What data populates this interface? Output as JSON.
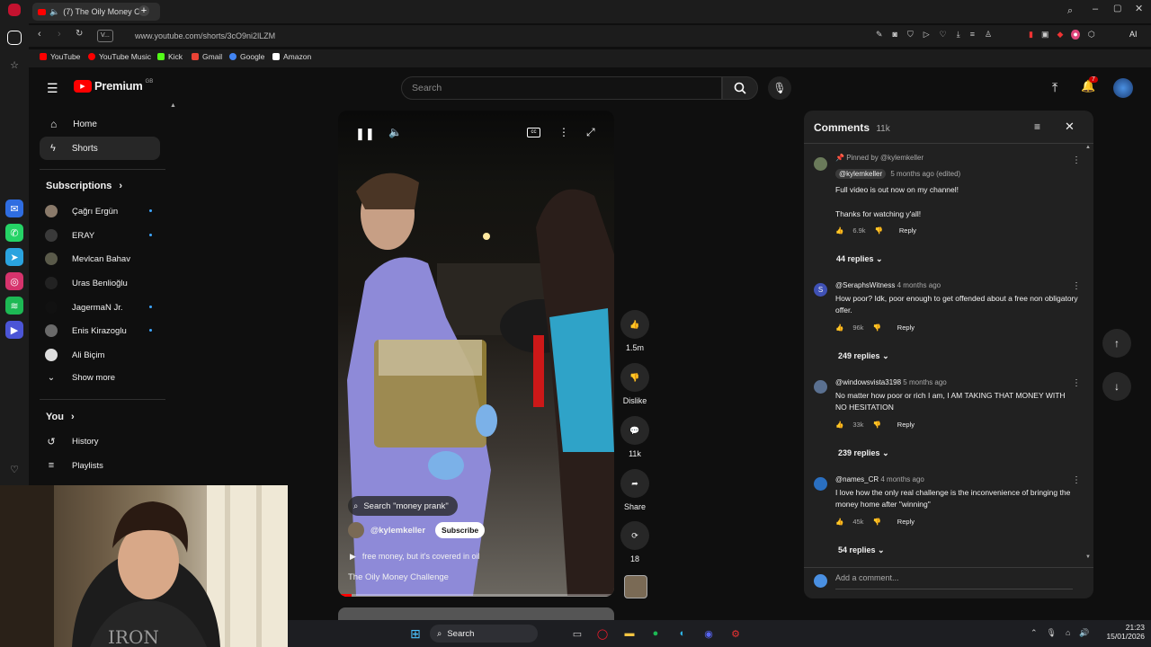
{
  "browser": {
    "tab_title": "(7) The Oily Money Ch",
    "url": "www.youtube.com/shorts/3cO9ni2lLZM",
    "view_badge": "V...",
    "ai_label": "AI",
    "bookmarks": [
      "YouTube",
      "YouTube Music",
      "Kick",
      "Gmail",
      "Google",
      "Amazon"
    ]
  },
  "header": {
    "logo": "Premium",
    "logo_badge": "GB",
    "search_placeholder": "Search",
    "notifications_count": "7"
  },
  "sidebar": {
    "items": [
      {
        "label": "Home",
        "icon": "home-icon"
      },
      {
        "label": "Shorts",
        "icon": "shorts-icon"
      }
    ],
    "subscriptions_title": "Subscriptions",
    "subscriptions": [
      {
        "name": "Çağrı Ergün",
        "live": true
      },
      {
        "name": "ERAY",
        "live": true
      },
      {
        "name": "Mevlcan Bahav",
        "live": false
      },
      {
        "name": "Uras Benlioğlu",
        "live": false
      },
      {
        "name": "JagermaN Jr.",
        "live": true
      },
      {
        "name": "Enis Kirazoglu",
        "live": true
      },
      {
        "name": "Ali Biçim",
        "live": false
      }
    ],
    "show_more": "Show more",
    "you_title": "You",
    "you_items": [
      {
        "label": "History",
        "icon": "history-icon"
      },
      {
        "label": "Playlists",
        "icon": "playlists-icon"
      }
    ]
  },
  "short": {
    "search_chip": "Search \"money prank\"",
    "channel": "@kylemkeller",
    "subscribe": "Subscribe",
    "audio": "free money, but it's covered in oil",
    "title": "The Oily Money Challenge",
    "actions": {
      "likes": "1.5m",
      "dislike": "Dislike",
      "comments": "11k",
      "share": "Share",
      "remix": "18"
    },
    "progress": 0.05
  },
  "comments": {
    "title": "Comments",
    "count": "11k",
    "pinned_by": "Pinned by @kylemkeller",
    "items": [
      {
        "author": "@kylemkeller",
        "time": "5 months ago (edited)",
        "text": "Full video is out now on my channel!",
        "text2": "Thanks for watching y'all!",
        "likes": "6.9k",
        "reply": "Reply",
        "replies": "44 replies",
        "avatar_color": "#6a7a5a"
      },
      {
        "author": "@SeraphsWitness",
        "time": "4 months ago",
        "text": "How poor? Idk, poor enough to get offended about a free non obligatory offer.",
        "likes": "96k",
        "reply": "Reply",
        "replies": "249 replies",
        "avatar_color": "#3f51b5",
        "avatar_letter": "S"
      },
      {
        "author": "@windowsvista3198",
        "time": "5 months ago",
        "text": "No matter how poor or rich I am, I AM TAKING THAT MONEY WITH NO HESITATION",
        "likes": "33k",
        "reply": "Reply",
        "replies": "239 replies",
        "avatar_color": "#5a7090"
      },
      {
        "author": "@names_CR",
        "time": "4 months ago",
        "text": "I love how the only real challenge is the inconvenience of bringing the money home after \"winning\"",
        "likes": "45k",
        "reply": "Reply",
        "replies": "54 replies",
        "avatar_color": "#2a6fc0"
      }
    ],
    "add_placeholder": "Add a comment..."
  },
  "taskbar": {
    "search": "Search",
    "time": "21:23",
    "date": "15/01/2026"
  },
  "colors": {
    "brand_red": "#ff0000",
    "link_blue": "#3ea6ff",
    "bg": "#0f0f0f",
    "panel": "#212121"
  }
}
